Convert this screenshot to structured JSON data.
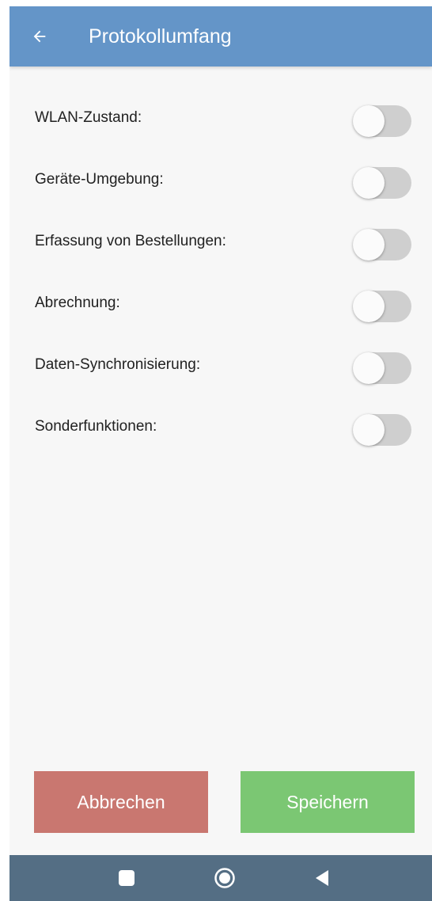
{
  "app_bar": {
    "title": "Protokollumfang",
    "back_icon": "arrow-left-icon",
    "background_color": "#6495c8"
  },
  "settings": [
    {
      "label": "WLAN-Zustand:",
      "enabled": false
    },
    {
      "label": "Geräte-Umgebung:",
      "enabled": false
    },
    {
      "label": "Erfassung von Bestellungen:",
      "enabled": false
    },
    {
      "label": "Abrechnung:",
      "enabled": false
    },
    {
      "label": "Daten-Synchronisierung:",
      "enabled": false
    },
    {
      "label": "Sonderfunktionen:",
      "enabled": false
    }
  ],
  "buttons": {
    "cancel_label": "Abbrechen",
    "cancel_color": "#c97770",
    "save_label": "Speichern",
    "save_color": "#7bc773"
  },
  "nav_bar": {
    "recent_icon": "square-icon",
    "home_icon": "circle-home-icon",
    "back_icon": "triangle-back-icon",
    "background_color": "#546e84"
  }
}
